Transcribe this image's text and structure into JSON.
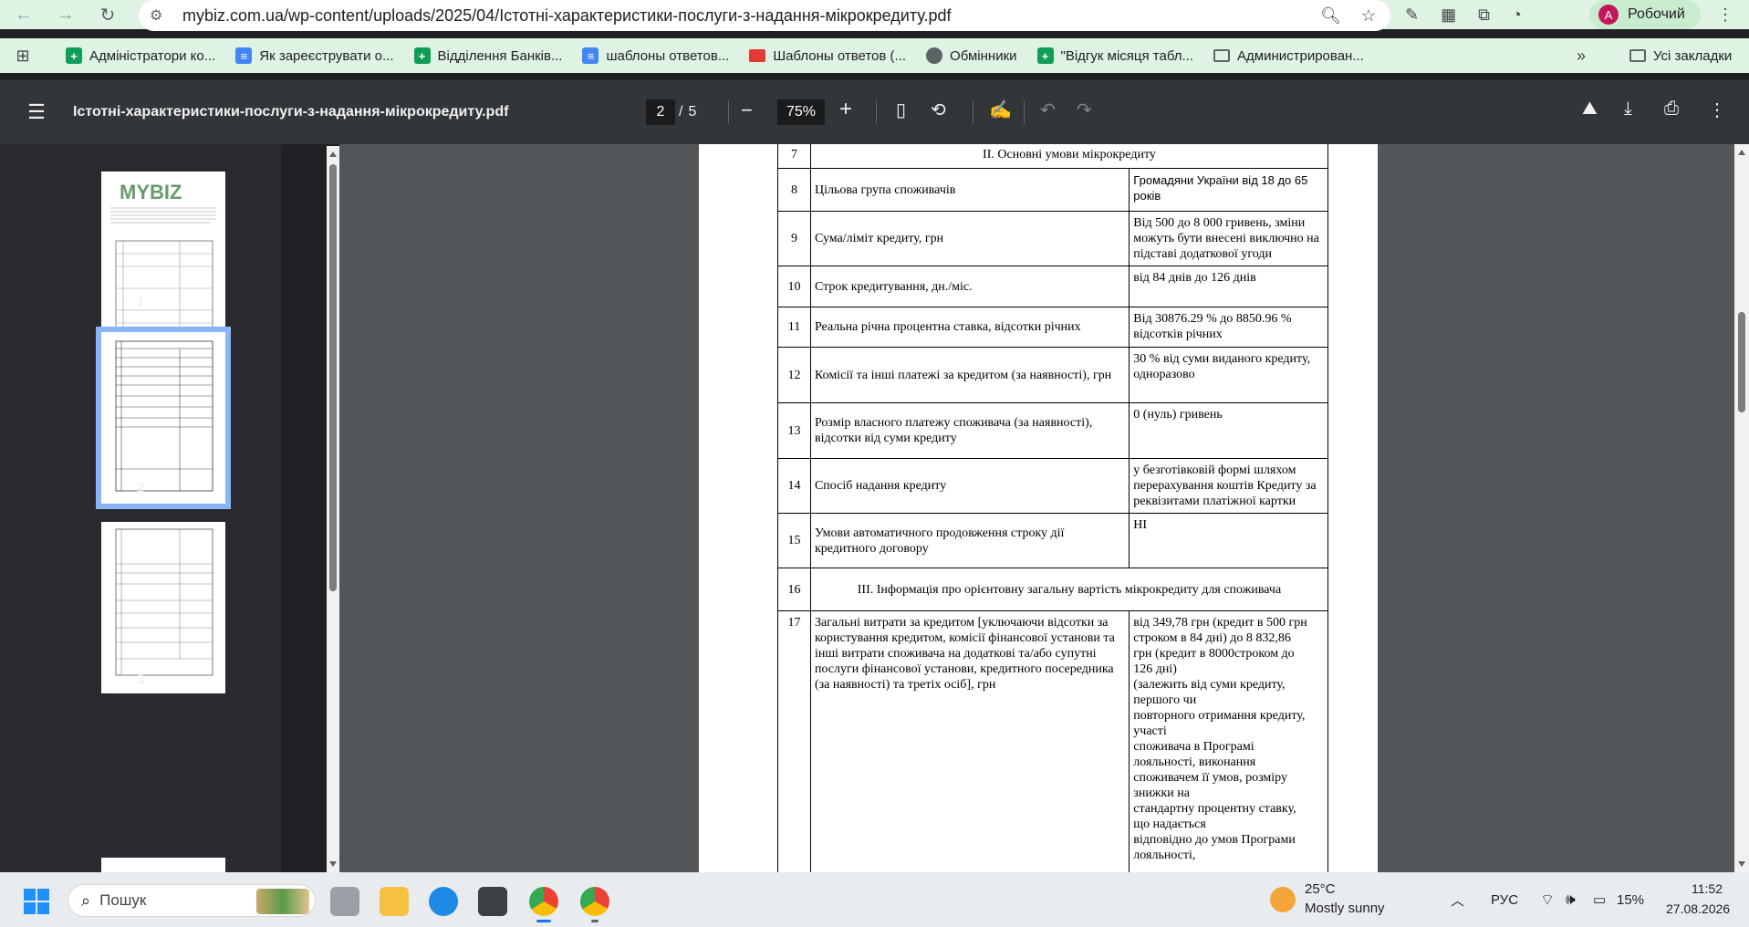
{
  "browser": {
    "url": "mybiz.com.ua/wp-content/uploads/2025/04/Істотні-характеристики-послуги-з-надання-мікрокредиту.pdf",
    "profile_initial": "A",
    "profile_name": "Робочий"
  },
  "bookmarks": [
    {
      "label": "Адміністратори ко...",
      "icon": "sheets-icon"
    },
    {
      "label": "Як зареєструвати о...",
      "icon": "docs-icon"
    },
    {
      "label": "Відділення Банків...",
      "icon": "sheets-icon"
    },
    {
      "label": "шаблоны ответов...",
      "icon": "docs-icon"
    },
    {
      "label": "Шаблоны ответов (...",
      "icon": "slides-icon"
    },
    {
      "label": "Обмінники",
      "icon": "globe-icon"
    },
    {
      "label": "\"Відгук місяця табл...",
      "icon": "sheets-icon"
    },
    {
      "label": "Администрирован...",
      "icon": "folder-icon"
    }
  ],
  "bookmarks_all": "Усі закладки",
  "viewer": {
    "title": "Істотні-характеристики-послуги-з-надання-мікрокредиту.pdf",
    "page_current": "2",
    "page_sep": "/",
    "page_total": "5",
    "zoom": "75%"
  },
  "thumbnails": [
    {
      "label": "1",
      "logo": "MYBIZ"
    },
    {
      "label": "2"
    },
    {
      "label": "3"
    }
  ],
  "table": {
    "rows": [
      {
        "num": "7",
        "section": "II. Основні умови мікрокредиту"
      },
      {
        "num": "8",
        "label": "Цільова група споживачів",
        "value": "Громадяни України від 18 до 65 років"
      },
      {
        "num": "9",
        "label": "Сума/ліміт кредиту, грн",
        "value": "Від 500 до 8 000 гривень, зміни можуть бути внесені виключно на підставі додаткової угоди"
      },
      {
        "num": "10",
        "label": "Строк кредитування, дн./міс.",
        "value": "від 84 днів до 126 днів"
      },
      {
        "num": "11",
        "label": "Реальна річна процентна ставка, відсотки річних",
        "value": " Від 30876.29 % до 8850.96 % відсотків річних"
      },
      {
        "num": "12",
        "label": "Комісії та інші платежі за кредитом (за наявності), грн",
        "value": "30 % від суми виданого кредиту, одноразово"
      },
      {
        "num": "13",
        "label": "Розмір власного платежу споживача (за наявності), відсотки від суми кредиту",
        "value": "0 (нуль) гривень"
      },
      {
        "num": "14",
        "label": "Спосіб надання кредиту",
        "value": "у безготівковій формі шляхом перерахування коштів Кредиту за реквізитами платіжної картки"
      },
      {
        "num": "15",
        "label": "Умови автоматичного продовження строку дії кредитного договору",
        "value": "НІ"
      },
      {
        "num": "16",
        "section": "III. Інформація про орієнтовну загальну вартість мікрокредиту для споживача"
      },
      {
        "num": "17",
        "label": "Загальні витрати за кредитом [уключаючи відсотки за користування кредитом, комісії фінансової установи та інші витрати споживача на додаткові та/або супутні послуги фінансової установи, кредитного посередника (за наявності) та третіх осіб], грн",
        "value_lines": [
          "від 349,78 грн (кредит в 500 грн",
          "строком в 84 дні) до 8 832,86",
          "грн (кредит в 8000строком до",
          "126 днi)",
          "(залежить від суми кредиту,",
          "першого чи",
          "повторного отримання кредиту,",
          "участі",
          "споживача в Програмі",
          "лояльності, виконання",
          "споживачем її умов, розміру",
          "знижки на",
          "стандартну процентну ставку,",
          "що надається",
          "відповідно до умов Програми",
          "лояльності,"
        ]
      }
    ]
  },
  "taskbar": {
    "search_placeholder": "Пошук",
    "weather_temp": "25°C",
    "weather_desc": "Mostly sunny",
    "lang": "РУС",
    "battery": "15%",
    "time": "11:52",
    "date": "27.08.2026"
  }
}
